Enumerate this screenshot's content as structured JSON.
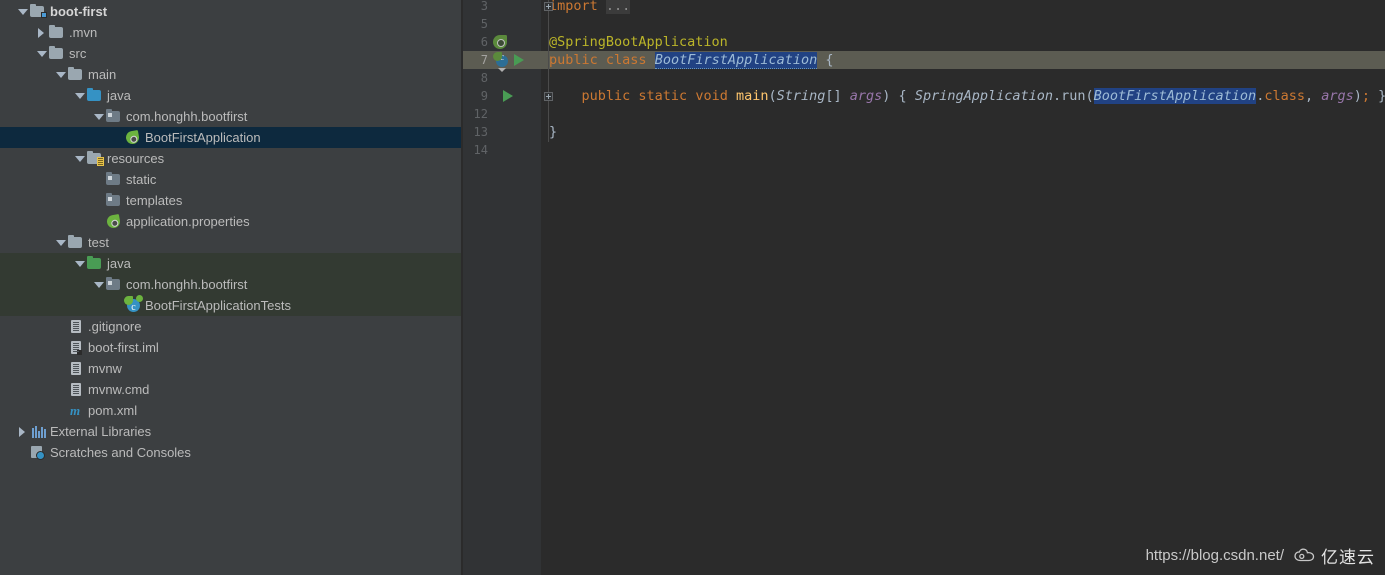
{
  "project_tree": {
    "name": "project-tool-window",
    "items": [
      {
        "label": "boot-first",
        "indent": 0,
        "arrow": "down",
        "icon": "module-folder-icon",
        "state": "bold"
      },
      {
        "label": ".mvn",
        "indent": 1,
        "arrow": "right",
        "icon": "folder-icon",
        "state": "normal"
      },
      {
        "label": "src",
        "indent": 1,
        "arrow": "down",
        "icon": "folder-icon",
        "state": "normal"
      },
      {
        "label": "main",
        "indent": 2,
        "arrow": "down",
        "icon": "folder-icon",
        "state": "normal"
      },
      {
        "label": "java",
        "indent": 3,
        "arrow": "down",
        "icon": "source-root-folder-icon",
        "state": "normal"
      },
      {
        "label": "com.honghh.bootfirst",
        "indent": 4,
        "arrow": "down",
        "icon": "package-folder-icon",
        "state": "normal"
      },
      {
        "label": "BootFirstApplication",
        "indent": 5,
        "arrow": "none",
        "icon": "spring-class-icon",
        "state": "selected"
      },
      {
        "label": "resources",
        "indent": 3,
        "arrow": "down",
        "icon": "resource-root-folder-icon",
        "state": "normal"
      },
      {
        "label": "static",
        "indent": 4,
        "arrow": "none",
        "icon": "package-folder-icon",
        "state": "normal"
      },
      {
        "label": "templates",
        "indent": 4,
        "arrow": "none",
        "icon": "package-folder-icon",
        "state": "normal"
      },
      {
        "label": "application.properties",
        "indent": 4,
        "arrow": "none",
        "icon": "spring-properties-icon",
        "state": "normal"
      },
      {
        "label": "test",
        "indent": 2,
        "arrow": "down",
        "icon": "folder-icon",
        "state": "normal"
      },
      {
        "label": "java",
        "indent": 3,
        "arrow": "down",
        "icon": "test-source-root-icon",
        "state": "tint-test"
      },
      {
        "label": "com.honghh.bootfirst",
        "indent": 4,
        "arrow": "down",
        "icon": "package-folder-icon",
        "state": "tint-test"
      },
      {
        "label": "BootFirstApplicationTests",
        "indent": 5,
        "arrow": "none",
        "icon": "test-class-icon",
        "state": "tint-test"
      },
      {
        "label": ".gitignore",
        "indent": 2,
        "arrow": "none",
        "icon": "text-file-icon",
        "state": "normal"
      },
      {
        "label": "boot-first.iml",
        "indent": 2,
        "arrow": "none",
        "icon": "iml-file-icon",
        "state": "normal"
      },
      {
        "label": "mvnw",
        "indent": 2,
        "arrow": "none",
        "icon": "text-file-icon",
        "state": "normal"
      },
      {
        "label": "mvnw.cmd",
        "indent": 2,
        "arrow": "none",
        "icon": "text-file-icon",
        "state": "normal"
      },
      {
        "label": "pom.xml",
        "indent": 2,
        "arrow": "none",
        "icon": "maven-pom-icon",
        "state": "normal"
      },
      {
        "label": "External Libraries",
        "indent": 0,
        "arrow": "right",
        "icon": "external-libraries-icon",
        "state": "normal"
      },
      {
        "label": "Scratches and Consoles",
        "indent": 0,
        "arrow": "none",
        "icon": "scratches-icon",
        "state": "normal"
      }
    ]
  },
  "editor": {
    "name": "code-editor",
    "caret_line_number": "7",
    "gutter_line_numbers": [
      "3",
      "5",
      "6",
      "7",
      "8",
      "9",
      "12",
      "13",
      "14"
    ],
    "lines": [
      {
        "num": "3",
        "tokens": [
          {
            "t": "import ",
            "c": "kw"
          },
          {
            "t": "...",
            "c": "fold-txt"
          }
        ]
      },
      {
        "num": "5",
        "tokens": []
      },
      {
        "num": "6",
        "tokens": [
          {
            "t": "@SpringBootApplication",
            "c": "anno-spring"
          }
        ]
      },
      {
        "num": "7",
        "tokens": [
          {
            "t": "public ",
            "c": "kw"
          },
          {
            "t": "class ",
            "c": "kw"
          },
          {
            "t": "BootFirstApplication",
            "c": "hl-ident"
          },
          {
            "t": " {",
            "c": "punc"
          }
        ]
      },
      {
        "num": "8",
        "tokens": []
      },
      {
        "num": "9",
        "tokens": [
          {
            "t": "    public ",
            "c": "kw"
          },
          {
            "t": "static ",
            "c": "kw"
          },
          {
            "t": "void ",
            "c": "kw"
          },
          {
            "t": "main",
            "c": "mth"
          },
          {
            "t": "(",
            "c": "punc"
          },
          {
            "t": "String",
            "c": "cls"
          },
          {
            "t": "[] ",
            "c": "punc"
          },
          {
            "t": "args",
            "c": "fld"
          },
          {
            "t": ") { ",
            "c": "punc"
          },
          {
            "t": "SpringApplication",
            "c": "cls"
          },
          {
            "t": ".run(",
            "c": "punc"
          },
          {
            "t": "BootFirstApplication",
            "c": "hl-sel"
          },
          {
            "t": ".",
            "c": "punc"
          },
          {
            "t": "class",
            "c": "kw"
          },
          {
            "t": ", ",
            "c": "punc"
          },
          {
            "t": "args",
            "c": "fld"
          },
          {
            "t": ")",
            "c": "punc"
          },
          {
            "t": ";",
            "c": "kw"
          },
          {
            "t": " }",
            "c": "punc"
          }
        ]
      },
      {
        "num": "12",
        "tokens": []
      },
      {
        "num": "13",
        "tokens": [
          {
            "t": "}",
            "c": "punc"
          }
        ]
      },
      {
        "num": "14",
        "tokens": []
      }
    ],
    "gutter_markers": [
      {
        "kind": "fold-collapsed-icon",
        "line": "3"
      },
      {
        "kind": "spring-bean-gutter-icon",
        "line": "6"
      },
      {
        "kind": "spring-run-class-gutter-icon",
        "line": "7"
      },
      {
        "kind": "run-method-gutter-icon",
        "line": "7"
      },
      {
        "kind": "run-method-gutter-icon",
        "line": "9"
      },
      {
        "kind": "fold-expand-icon",
        "line": "9"
      }
    ]
  },
  "watermark": {
    "name": "csdn-watermark",
    "url": "https://blog.csdn.net/",
    "logo_text": "亿速云",
    "logo_icon": "cloud-icon"
  },
  "colors": {
    "sidebar_bg": "#3c3f41",
    "editor_bg": "#2b2b2b",
    "gutter_bg": "#313335",
    "selection_bg": "#0d293e",
    "test_root_tint": "#333a32",
    "caret_row_bg": "#5c5c52",
    "keyword": "#cc7832",
    "annotation": "#bbb529",
    "method": "#ffc66d",
    "field": "#9876aa",
    "text": "#a9b7c6",
    "identifier_highlight": "#214283"
  }
}
